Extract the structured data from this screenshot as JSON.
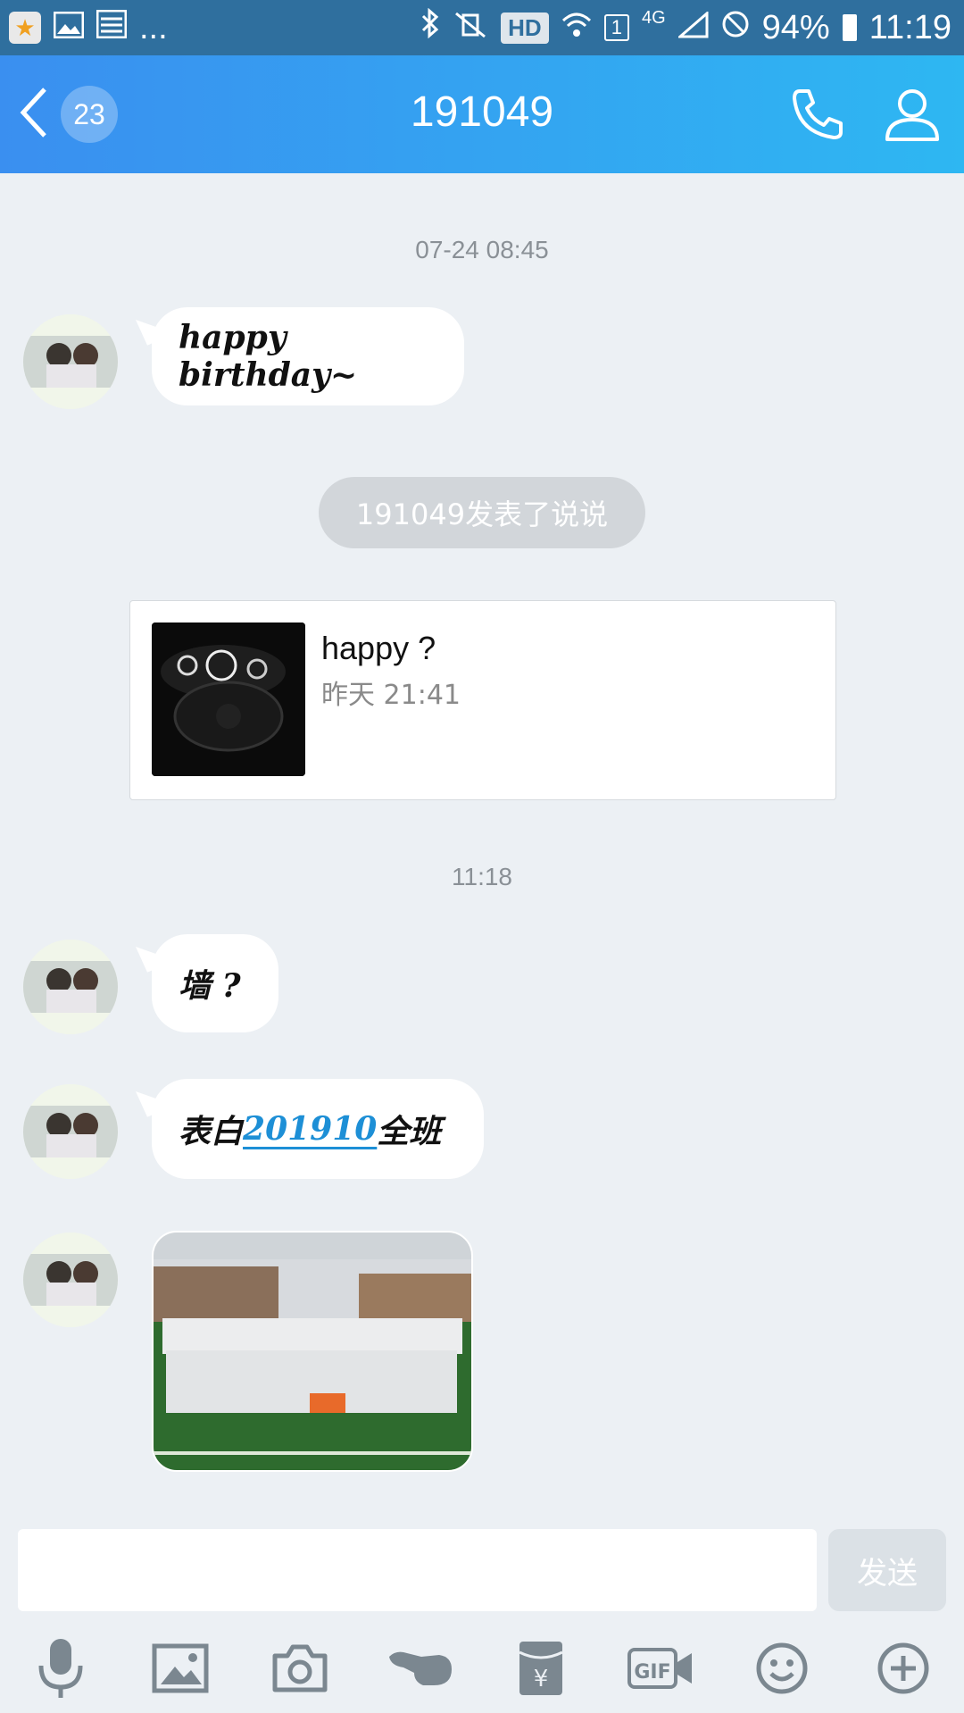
{
  "status_bar": {
    "overflow_text": "...",
    "hd_label": "HD",
    "sim_label": "1",
    "network": "4G",
    "battery": "94%",
    "time": "11:19"
  },
  "header": {
    "unread_count": "23",
    "title": "191049"
  },
  "messages": {
    "timestamp_1": "07-24 08:45",
    "msg_1": "happy birthday~",
    "system_notice": "191049发表了说说",
    "shared_post": {
      "title": "happy ?",
      "time": "昨天 21:41"
    },
    "timestamp_2": "11:18",
    "msg_2": "墙 ?",
    "msg_3_prefix": "表白",
    "msg_3_link": "201910",
    "msg_3_suffix": "全班"
  },
  "input": {
    "placeholder": "",
    "send_label": "发送"
  },
  "toolbar": {
    "items": [
      "microphone-icon",
      "image-icon",
      "camera-icon",
      "poke-icon",
      "red-packet-icon",
      "gif-icon",
      "emoji-icon",
      "plus-icon"
    ]
  },
  "colors": {
    "header_start": "#3a8ff0",
    "header_end": "#2eb7f2",
    "background": "#ecf0f4",
    "link": "#1d8fd6"
  }
}
